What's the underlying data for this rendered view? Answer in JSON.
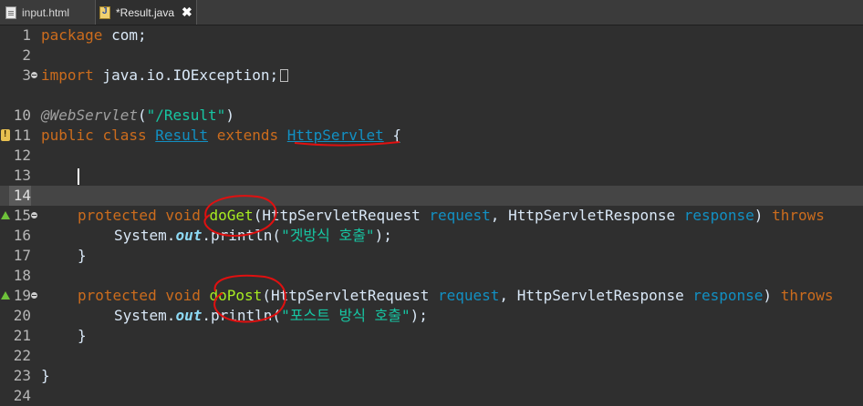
{
  "tabs": [
    {
      "label": "input.html",
      "icon": "html-file-icon",
      "active": false
    },
    {
      "label": "*Result.java",
      "icon": "java-file-icon",
      "active": true,
      "close": "✖"
    }
  ],
  "editor": {
    "lines": [
      {
        "n": "1"
      },
      {
        "n": "2"
      },
      {
        "n": "3"
      },
      {
        "n": "10"
      },
      {
        "n": "11"
      },
      {
        "n": "12"
      },
      {
        "n": "13"
      },
      {
        "n": "14"
      },
      {
        "n": "15"
      },
      {
        "n": "16"
      },
      {
        "n": "17"
      },
      {
        "n": "18"
      },
      {
        "n": "19"
      },
      {
        "n": "20"
      },
      {
        "n": "21"
      },
      {
        "n": "22"
      },
      {
        "n": "23"
      },
      {
        "n": "24"
      }
    ],
    "t": {
      "package": "package",
      "com": " com;",
      "import": "import",
      "ioexc": " java.io.IOException;",
      "annotation": "@WebServlet",
      "paren_open": "(",
      "ann_str": "\"/Result\"",
      "paren_close": ")",
      "public": "public",
      "class": "class",
      "result": "Result",
      "extends": "extends",
      "httpservlet": "HttpServlet",
      "brace_open": " {",
      "protected": "protected",
      "void": "void",
      "doGet": "doGet",
      "doPost": "doPost",
      "req_type": "HttpServletRequest",
      "req": "request",
      "comma": ", ",
      "resp_type": "HttpServletResponse",
      "resp": "response",
      "throws": "throws",
      "system": "System",
      "dot": ".",
      "out": "out",
      "println": "println",
      "get_str": "\"겟방식 호출\"",
      "post_str": "\"포스트 방식 호출\"",
      "end": ");",
      "brace_close": "}"
    }
  },
  "colors": {
    "background": "#2f2f2f",
    "keyword": "#cc6c1d",
    "class": "#1290c3",
    "string": "#17c6a3",
    "field": "#8dd9f4",
    "method": "#a7ec21",
    "annotation_marks": "#e01010"
  }
}
